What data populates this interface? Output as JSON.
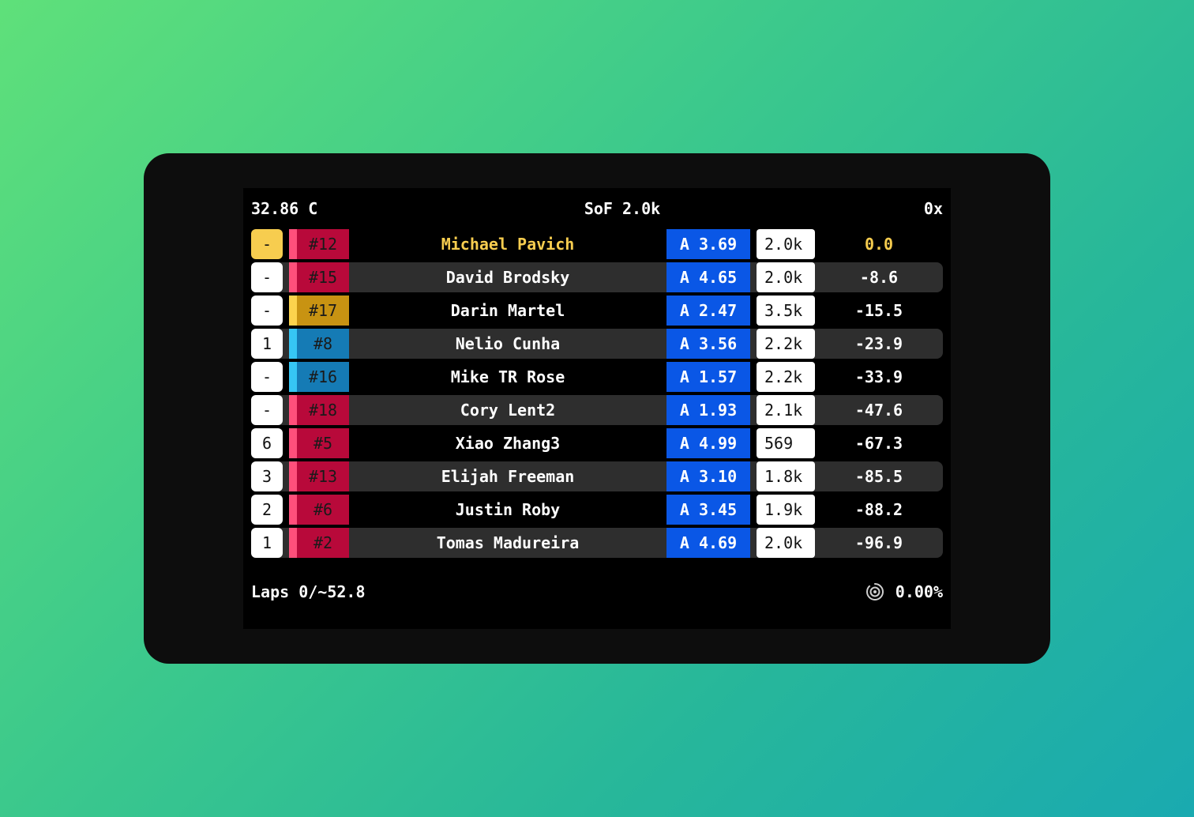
{
  "header": {
    "temperature": "32.86 C",
    "sof": "SoF 2.0k",
    "incidents": "0x"
  },
  "colors": {
    "highlight": "#f7cd4f",
    "license_blue": "#0a57e6",
    "class_pink": "#ff4f7b",
    "class_crimson": "#b8093a",
    "class_gold_stripe": "#fcd34d",
    "class_gold": "#c89312",
    "class_cyan_stripe": "#36c6f4",
    "class_blue": "#157bb5",
    "row_alt": "#2e2e2e"
  },
  "drivers": [
    {
      "pos": "-",
      "car": "#12",
      "name": "Michael Pavich",
      "license": "A 3.69",
      "irating": "2.0k",
      "gap": "0.0",
      "class": "red",
      "highlight": true
    },
    {
      "pos": "-",
      "car": "#15",
      "name": "David Brodsky",
      "license": "A 4.65",
      "irating": "2.0k",
      "gap": "-8.6",
      "class": "red",
      "highlight": false
    },
    {
      "pos": "-",
      "car": "#17",
      "name": "Darin Martel",
      "license": "A 2.47",
      "irating": "3.5k",
      "gap": "-15.5",
      "class": "gold",
      "highlight": false
    },
    {
      "pos": "1",
      "car": "#8",
      "name": "Nelio Cunha",
      "license": "A 3.56",
      "irating": "2.2k",
      "gap": "-23.9",
      "class": "blue",
      "highlight": false
    },
    {
      "pos": "-",
      "car": "#16",
      "name": "Mike TR Rose",
      "license": "A 1.57",
      "irating": "2.2k",
      "gap": "-33.9",
      "class": "blue",
      "highlight": false
    },
    {
      "pos": "-",
      "car": "#18",
      "name": "Cory Lent2",
      "license": "A 1.93",
      "irating": "2.1k",
      "gap": "-47.6",
      "class": "red",
      "highlight": false
    },
    {
      "pos": "6",
      "car": "#5",
      "name": "Xiao Zhang3",
      "license": "A 4.99",
      "irating": "569",
      "gap": "-67.3",
      "class": "red",
      "highlight": false
    },
    {
      "pos": "3",
      "car": "#13",
      "name": "Elijah Freeman",
      "license": "A 3.10",
      "irating": "1.8k",
      "gap": "-85.5",
      "class": "red",
      "highlight": false
    },
    {
      "pos": "2",
      "car": "#6",
      "name": "Justin Roby",
      "license": "A 3.45",
      "irating": "1.9k",
      "gap": "-88.2",
      "class": "red",
      "highlight": false
    },
    {
      "pos": "1",
      "car": "#2",
      "name": "Tomas Madureira",
      "license": "A 4.69",
      "irating": "2.0k",
      "gap": "-96.9",
      "class": "red",
      "highlight": false
    }
  ],
  "footer": {
    "laps": "Laps 0/~52.8",
    "fuel_icon": "fuel-target-icon",
    "percent": "0.00%"
  }
}
